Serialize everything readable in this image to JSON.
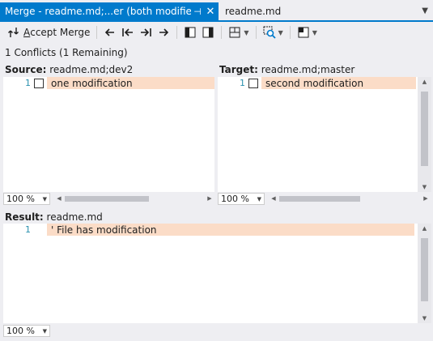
{
  "tabs": {
    "active_title": "Merge - readme.md;...er (both modified)*",
    "active_pin": "⊣",
    "active_close": "✕",
    "inactive_title": "readme.md",
    "overflow": "▼"
  },
  "toolbar": {
    "accept_merge_label_u": "A",
    "accept_merge_label_rest": "ccept Merge"
  },
  "info": {
    "conflicts": "1 Conflicts (1 Remaining)"
  },
  "source": {
    "label": "Source:",
    "file": "readme.md;dev2",
    "lines": [
      {
        "num": "1",
        "text": "one modification"
      }
    ],
    "zoom": "100 %"
  },
  "target": {
    "label": "Target:",
    "file": "readme.md;master",
    "lines": [
      {
        "num": "1",
        "text": "second modification"
      }
    ],
    "zoom": "100 %"
  },
  "result": {
    "label": "Result:",
    "file": "readme.md",
    "lines": [
      {
        "num": "1",
        "text": "' File has modification"
      }
    ],
    "zoom": "100 %"
  },
  "colors": {
    "accent": "#007acc",
    "conflict_highlight": "#fbdcc7",
    "line_number": "#2b91af"
  }
}
